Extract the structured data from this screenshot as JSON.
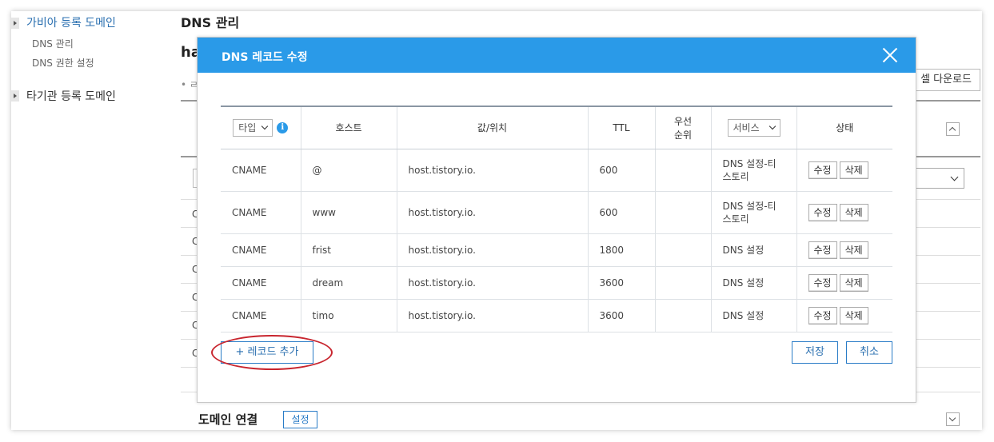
{
  "nav": {
    "section1_title": "가비아 등록 도메인",
    "section1_items": [
      "DNS 관리",
      "DNS 권한 설정"
    ],
    "section2_title": "타기관 등록 도메인"
  },
  "background": {
    "page_title": "DNS 관리",
    "domain_fragment": "ha",
    "bullet_fragment": "• ㄹ",
    "excel_button": "셀 다운로드",
    "row_fragment": "C",
    "connect_title": "도메인 연결",
    "connect_button": "설정"
  },
  "modal": {
    "title": "DNS 레코드 수정",
    "headers": {
      "type_select": "타입",
      "host": "호스트",
      "value": "값/위치",
      "ttl": "TTL",
      "priority_line1": "우선",
      "priority_line2": "순위",
      "service_select": "서비스",
      "status": "상태"
    },
    "rows": [
      {
        "type": "CNAME",
        "host": "@",
        "value": "host.tistory.io.",
        "ttl": "600",
        "priority": "",
        "service_line1": "DNS 설정-티",
        "service_line2": "스토리",
        "edit": "수정",
        "delete": "삭제"
      },
      {
        "type": "CNAME",
        "host": "www",
        "value": "host.tistory.io.",
        "ttl": "600",
        "priority": "",
        "service_line1": "DNS 설정-티",
        "service_line2": "스토리",
        "edit": "수정",
        "delete": "삭제"
      },
      {
        "type": "CNAME",
        "host": "frist",
        "value": "host.tistory.io.",
        "ttl": "1800",
        "priority": "",
        "service_line1": "DNS 설정",
        "service_line2": "",
        "edit": "수정",
        "delete": "삭제"
      },
      {
        "type": "CNAME",
        "host": "dream",
        "value": "host.tistory.io.",
        "ttl": "3600",
        "priority": "",
        "service_line1": "DNS 설정",
        "service_line2": "",
        "edit": "수정",
        "delete": "삭제"
      },
      {
        "type": "CNAME",
        "host": "timo",
        "value": "host.tistory.io.",
        "ttl": "3600",
        "priority": "",
        "service_line1": "DNS 설정",
        "service_line2": "",
        "edit": "수정",
        "delete": "삭제"
      }
    ],
    "add_record_button": "+ 레코드 추가",
    "save_button": "저장",
    "cancel_button": "취소"
  },
  "colors": {
    "header_blue": "#2a9ae8",
    "link_blue": "#2a6fb0",
    "highlight_red": "#c8252e"
  },
  "icons": [
    "close-icon",
    "info-icon",
    "chevron-down-icon",
    "chevron-up-icon",
    "nav-arrow-icon"
  ]
}
